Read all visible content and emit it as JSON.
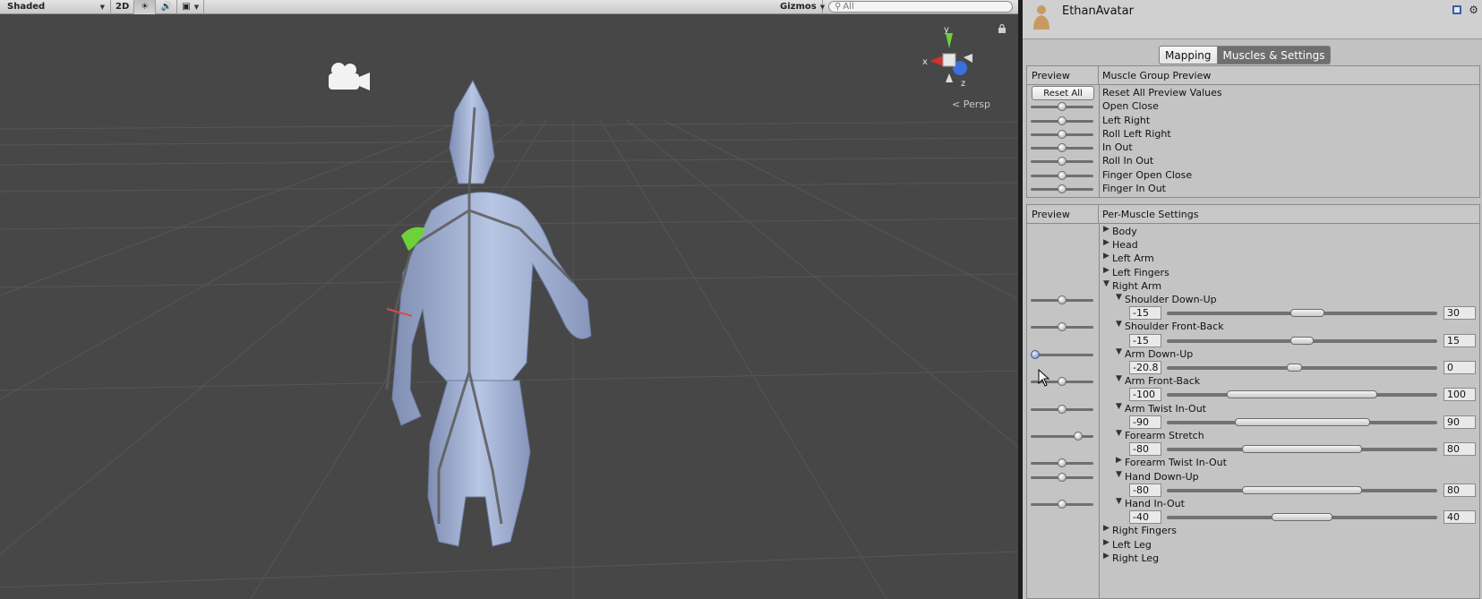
{
  "scene": {
    "toolbar": {
      "shading_mode": "Shaded",
      "mode_2d": "2D",
      "gizmos": "Gizmos",
      "search_placeholder": "All"
    },
    "persp_label": "Persp",
    "axis_labels": {
      "x": "x",
      "y": "y",
      "z": "z"
    }
  },
  "inspector": {
    "title": "EthanAvatar",
    "tabs": [
      {
        "label": "Mapping",
        "active": false
      },
      {
        "label": "Muscles & Settings",
        "active": true
      }
    ],
    "muscle_group": {
      "header_left": "Preview",
      "header_right": "Muscle Group Preview",
      "reset_button": "Reset All",
      "reset_label": "Reset All Preview Values",
      "items": [
        {
          "label": "Open Close",
          "preview": 0.5
        },
        {
          "label": "Left Right",
          "preview": 0.5
        },
        {
          "label": "Roll Left Right",
          "preview": 0.5
        },
        {
          "label": "In Out",
          "preview": 0.5
        },
        {
          "label": "Roll In Out",
          "preview": 0.5
        },
        {
          "label": "Finger Open Close",
          "preview": 0.5
        },
        {
          "label": "Finger In Out",
          "preview": 0.5
        }
      ]
    },
    "per_muscle": {
      "header_left": "Preview",
      "header_right": "Per-Muscle Settings",
      "groups_before": [
        {
          "label": "Body",
          "expanded": false
        },
        {
          "label": "Head",
          "expanded": false
        },
        {
          "label": "Left Arm",
          "expanded": false
        },
        {
          "label": "Left Fingers",
          "expanded": false
        }
      ],
      "right_arm": {
        "label": "Right Arm",
        "expanded": true,
        "muscles": [
          {
            "label": "Shoulder Down-Up",
            "expanded": true,
            "preview": 0.5,
            "min": "-15",
            "max": "30"
          },
          {
            "label": "Shoulder Front-Back",
            "expanded": true,
            "preview": 0.5,
            "min": "-15",
            "max": "15"
          },
          {
            "label": "Arm Down-Up",
            "expanded": true,
            "preview": 0.0,
            "min": "-20.8",
            "max": "0",
            "hot": true
          },
          {
            "label": "Arm Front-Back",
            "expanded": true,
            "preview": 0.5,
            "min": "-100",
            "max": "100"
          },
          {
            "label": "Arm Twist In-Out",
            "expanded": true,
            "preview": 0.5,
            "min": "-90",
            "max": "90"
          },
          {
            "label": "Forearm Stretch",
            "expanded": true,
            "preview": 0.8,
            "min": "-80",
            "max": "80"
          },
          {
            "label": "Forearm Twist In-Out",
            "expanded": false,
            "preview": 0.5
          },
          {
            "label": "Hand Down-Up",
            "expanded": true,
            "preview": 0.5,
            "min": "-80",
            "max": "80"
          },
          {
            "label": "Hand In-Out",
            "expanded": true,
            "preview": 0.5,
            "min": "-40",
            "max": "40"
          }
        ]
      },
      "groups_after": [
        {
          "label": "Right Fingers",
          "expanded": false
        },
        {
          "label": "Left Leg",
          "expanded": false
        },
        {
          "label": "Right Leg",
          "expanded": false
        }
      ]
    }
  },
  "colors": {
    "scene_bg": "#474747",
    "inspector_bg": "#c2c2c2",
    "figure": "#a9b7d6",
    "gizmo_x": "#d0312d",
    "gizmo_y": "#6fd13a",
    "gizmo_z": "#3a6fe0"
  }
}
